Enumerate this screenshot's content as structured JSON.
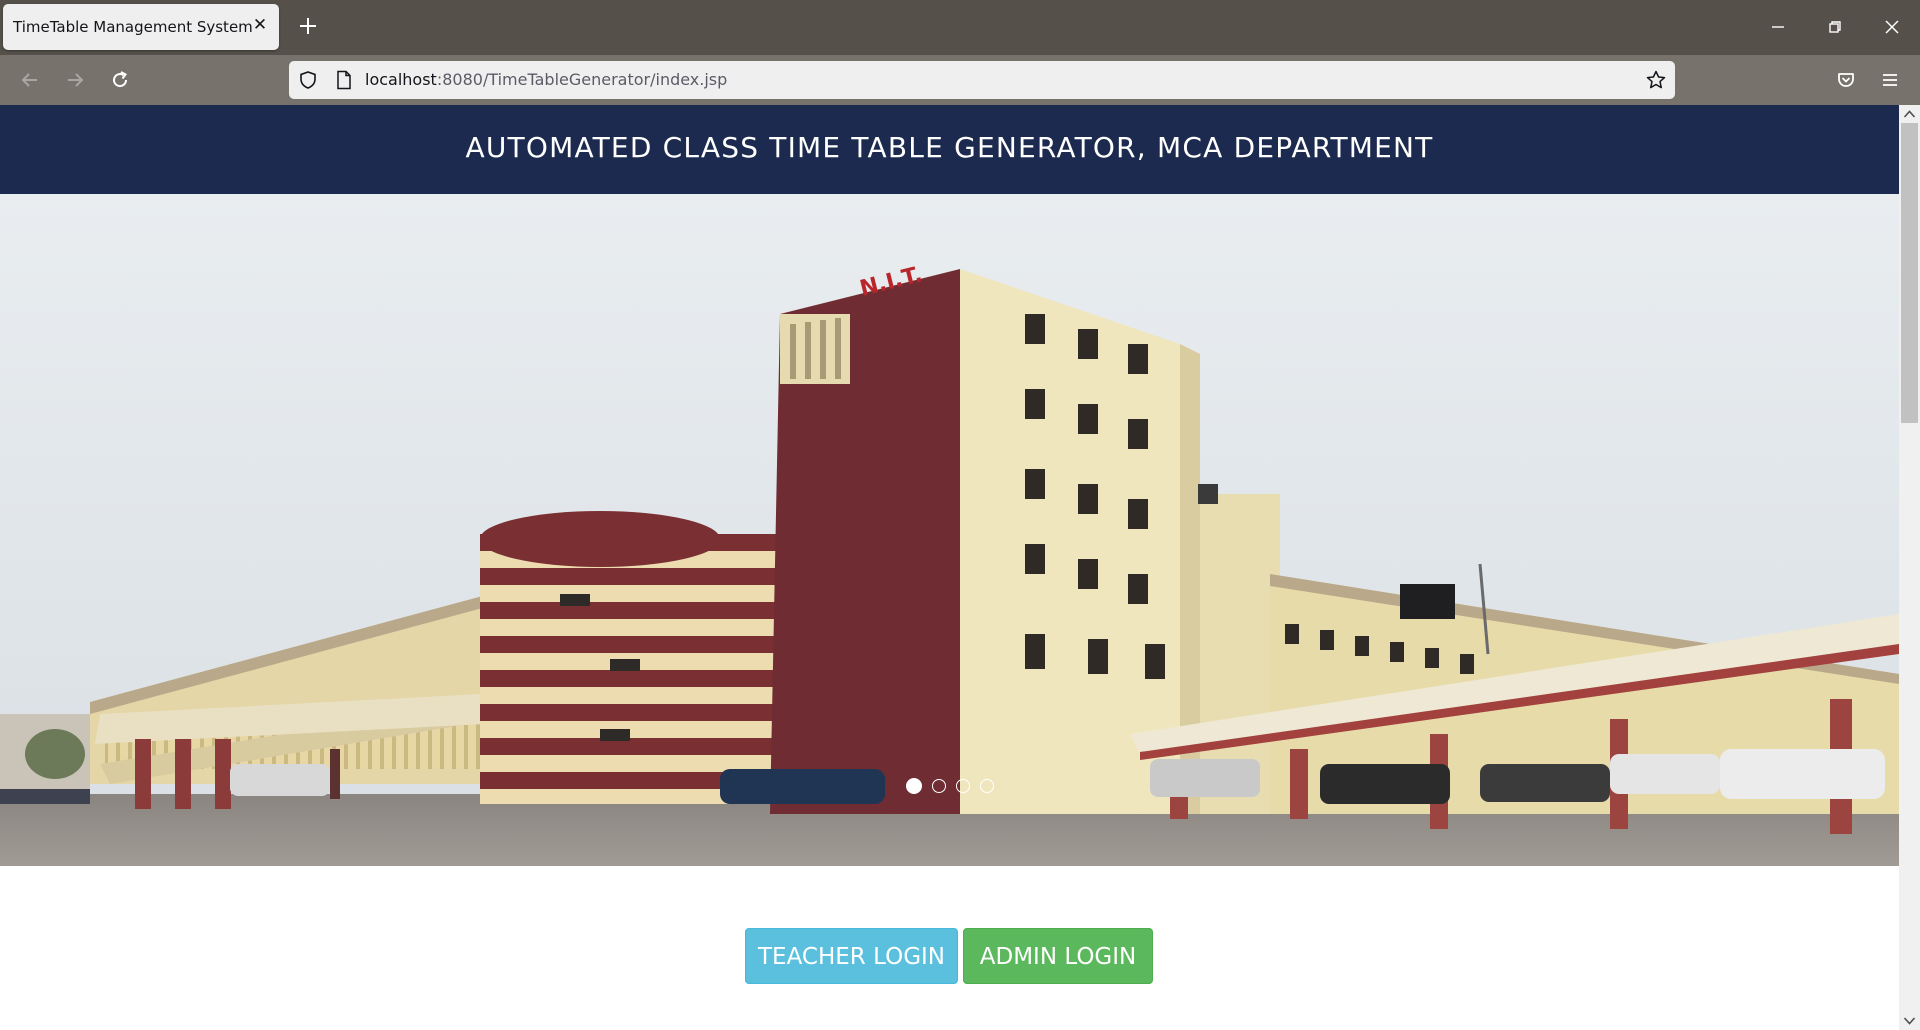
{
  "browser": {
    "tab_title": "TimeTable Management System",
    "tab_close_icon": "close-icon",
    "new_tab_icon": "plus-icon",
    "window_controls": [
      "minimize-icon",
      "restore-icon",
      "close-icon"
    ],
    "nav_icons": [
      "back-arrow-icon",
      "forward-arrow-icon",
      "reload-icon"
    ],
    "url_host": "localhost",
    "url_rest": ":8080/TimeTableGenerator/index.jsp",
    "toolbar_icons": [
      "pocket-icon",
      "menu-icon"
    ]
  },
  "page": {
    "header_title": "AUTOMATED CLASS TIME TABLE GENERATOR, MCA DEPARTMENT",
    "carousel": {
      "slide_count": 4,
      "active_index": 0,
      "image_sign_text": "N.I.T."
    },
    "buttons": {
      "teacher_login": "TEACHER LOGIN",
      "admin_login": "ADMIN LOGIN"
    }
  },
  "colors": {
    "header_bg": "#1b2a4e",
    "teacher_button": "#5bc0de",
    "admin_button": "#5cb85c",
    "tabstrip": "#55504a",
    "navbar": "#77726b"
  }
}
